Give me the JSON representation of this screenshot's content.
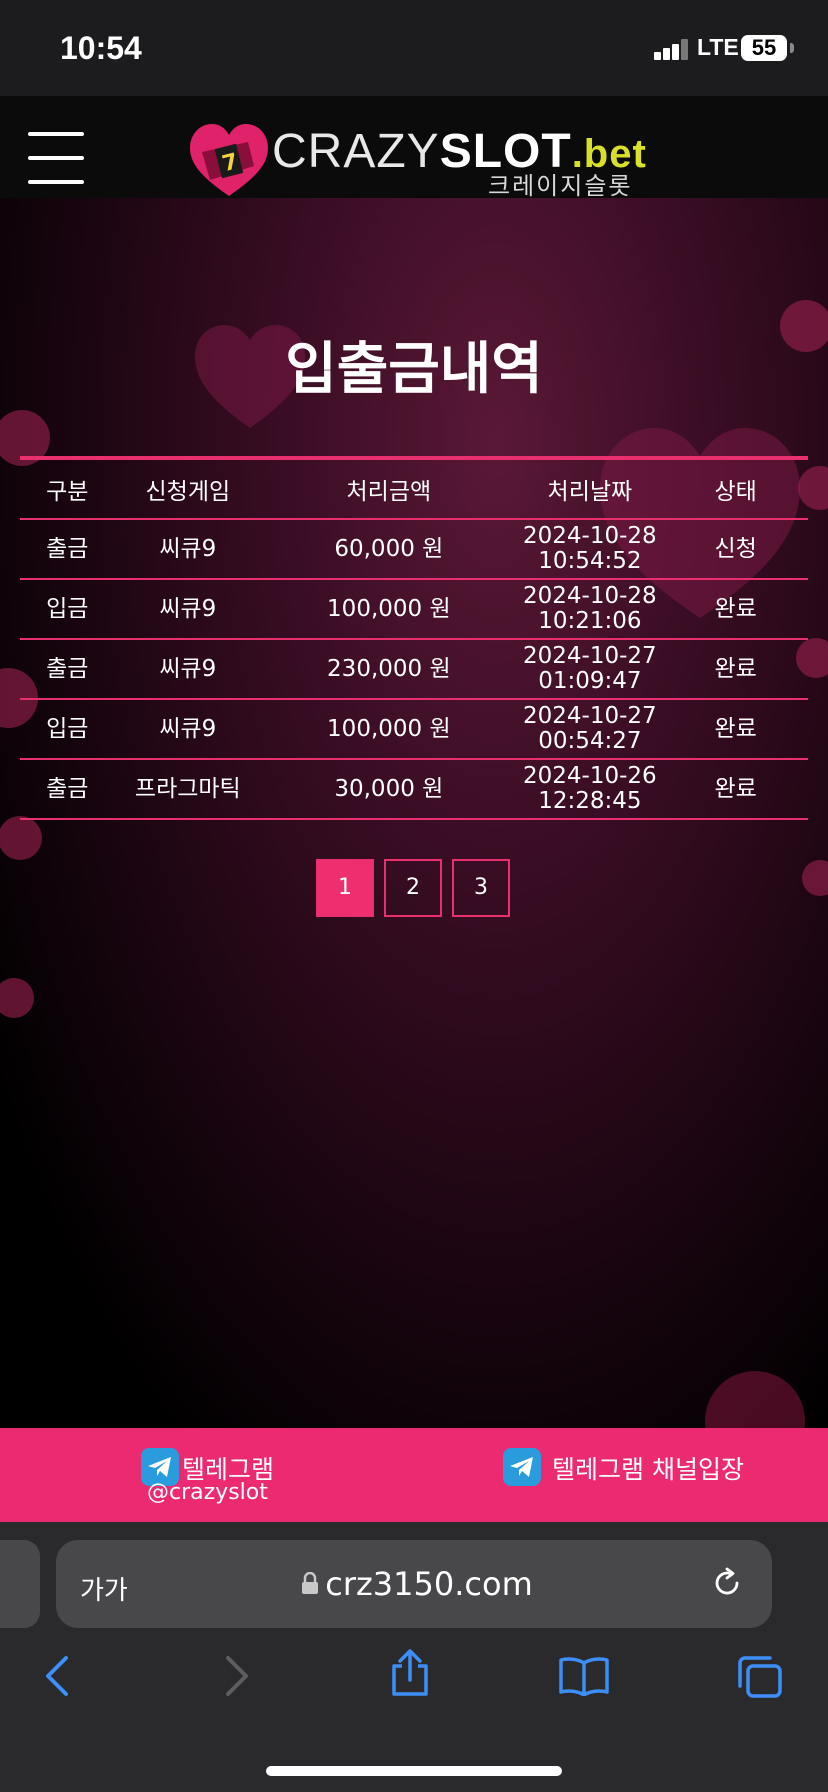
{
  "status_bar": {
    "time": "10:54",
    "network": "LTE",
    "battery": "55"
  },
  "header": {
    "logo": {
      "crazy": "CRAZY",
      "slot": "SLOT",
      "bet": ".bet",
      "subtitle": "크레이지슬롯"
    }
  },
  "page": {
    "title": "입출금내역"
  },
  "table": {
    "headers": [
      "구분",
      "신청게임",
      "처리금액",
      "처리날짜",
      "상태"
    ],
    "rows": [
      {
        "type": "출금",
        "game": "씨큐9",
        "amount": "60,000 원",
        "date": "2024-10-28",
        "time": "10:54:52",
        "status": "신청"
      },
      {
        "type": "입금",
        "game": "씨큐9",
        "amount": "100,000 원",
        "date": "2024-10-28",
        "time": "10:21:06",
        "status": "완료"
      },
      {
        "type": "출금",
        "game": "씨큐9",
        "amount": "230,000 원",
        "date": "2024-10-27",
        "time": "01:09:47",
        "status": "완료"
      },
      {
        "type": "입금",
        "game": "씨큐9",
        "amount": "100,000 원",
        "date": "2024-10-27",
        "time": "00:54:27",
        "status": "완료"
      },
      {
        "type": "출금",
        "game": "프라그마틱",
        "amount": "30,000 원",
        "date": "2024-10-26",
        "time": "12:28:45",
        "status": "완료"
      }
    ]
  },
  "pagination": {
    "pages": [
      "1",
      "2",
      "3"
    ],
    "current": "1"
  },
  "telegram": {
    "link1_label": "텔레그램",
    "link1_handle": "@crazyslot",
    "link2_label": "텔레그램 채널입장"
  },
  "browser": {
    "text_size_label": "가가",
    "url": "crz3150.com"
  },
  "colors": {
    "accent": "#eb2a71",
    "table_line": "#e8306f",
    "telegram": "#2a9bdc",
    "ios_blue": "#3d8ff7"
  }
}
